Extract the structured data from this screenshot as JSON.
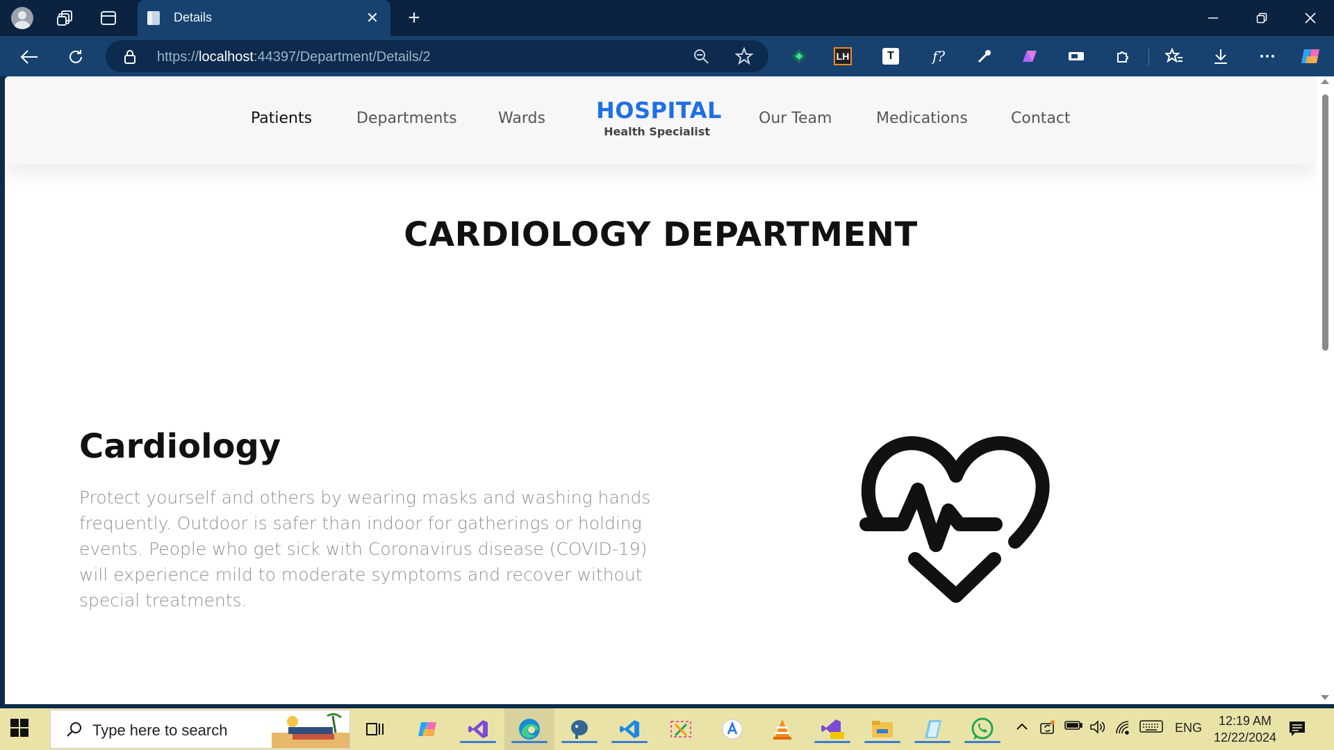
{
  "browser": {
    "tab_title": "Details",
    "url_prefix": "https://",
    "url_host": "localhost",
    "url_rest": ":44397/Department/Details/2"
  },
  "site": {
    "nav": {
      "patients": "Patients",
      "departments": "Departments",
      "wards": "Wards",
      "our_team": "Our Team",
      "medications": "Medications",
      "contact": "Contact"
    },
    "brand": {
      "title": "HOSPITAL",
      "subtitle": "Health Specialist"
    },
    "page_title": "CARDIOLOGY DEPARTMENT",
    "department": {
      "name": "Cardiology",
      "description": "Protect yourself and others by wearing masks and washing hands frequently. Outdoor is safer than indoor for gatherings or holding events. People who get sick with Coronavirus disease (COVID-19) will experience mild to moderate symptoms and recover without special treatments.",
      "icon": "heart-pulse-icon"
    },
    "colors": {
      "brand": "#1f6fe5"
    }
  },
  "extensions": {
    "lh_label": "LH",
    "t_label": "T",
    "f_label": "f?"
  },
  "taskbar": {
    "search_placeholder": "Type here to search",
    "tray_language": "ENG",
    "time": "12:19 AM",
    "date": "12/22/2024"
  }
}
